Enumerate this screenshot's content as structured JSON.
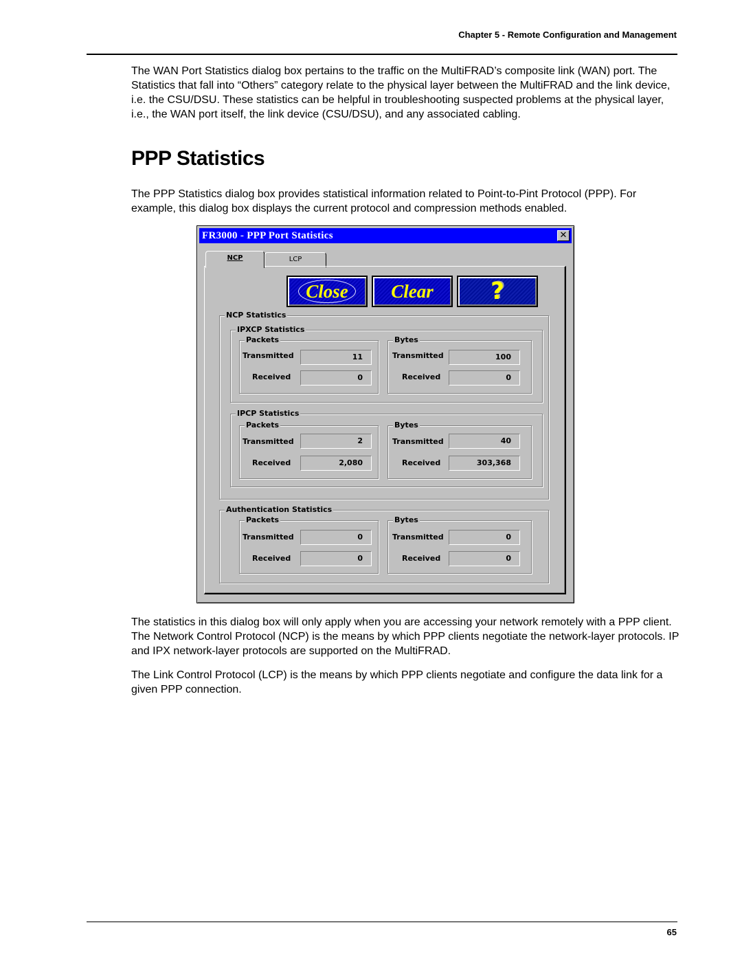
{
  "page": {
    "running_header": "Chapter 5 - Remote Configuration and Management",
    "page_number": "65",
    "section_title": "PPP Statistics",
    "paragraphs": [
      "The WAN Port Statistics dialog box pertains to the traffic on the MultiFRAD’s composite link (WAN) port.  The Statistics that fall into “Others” category relate to the physical layer between the MultiFRAD and the link device, i.e. the CSU/DSU.  These statistics can be helpful in troubleshooting suspected problems at the physical layer, i.e., the WAN port itself, the link device (CSU/DSU), and any associated cabling.",
      "The PPP Statistics dialog box provides statistical information related to Point-to-Pint Protocol (PPP). For example, this dialog box displays the current protocol and compression methods enabled.",
      "The statistics in this dialog box will only apply when you are accessing your network remotely with a PPP client.  The Network Control Protocol (NCP) is the means by which PPP clients negotiate the network-layer protocols.  IP and IPX network-layer protocols are supported on the MultiFRAD.",
      "The Link Control Protocol (LCP) is the means by which PPP clients negotiate and configure the data link for a given PPP connection."
    ]
  },
  "dialog": {
    "title": "FR3000 - PPP Port Statistics",
    "close_glyph": "✕",
    "tabs": [
      {
        "label": "NCP",
        "active": true
      },
      {
        "label": "LCP",
        "active": false
      }
    ],
    "buttons": {
      "close": "Close",
      "clear": "Clear",
      "help": "?"
    },
    "ncp_group_label": "NCP Statistics",
    "labels": {
      "packets": "Packets",
      "bytes": "Bytes",
      "transmitted": "Transmitted",
      "received": "Received"
    },
    "ipxcp": {
      "label": "IPXCP Statistics",
      "packets": {
        "transmitted": "11",
        "received": "0"
      },
      "bytes": {
        "transmitted": "100",
        "received": "0"
      }
    },
    "ipcp": {
      "label": "IPCP Statistics",
      "packets": {
        "transmitted": "2",
        "received": "2,080"
      },
      "bytes": {
        "transmitted": "40",
        "received": "303,368"
      }
    },
    "auth": {
      "label": "Authentication Statistics",
      "packets": {
        "transmitted": "0",
        "received": "0"
      },
      "bytes": {
        "transmitted": "0",
        "received": "0"
      }
    }
  }
}
